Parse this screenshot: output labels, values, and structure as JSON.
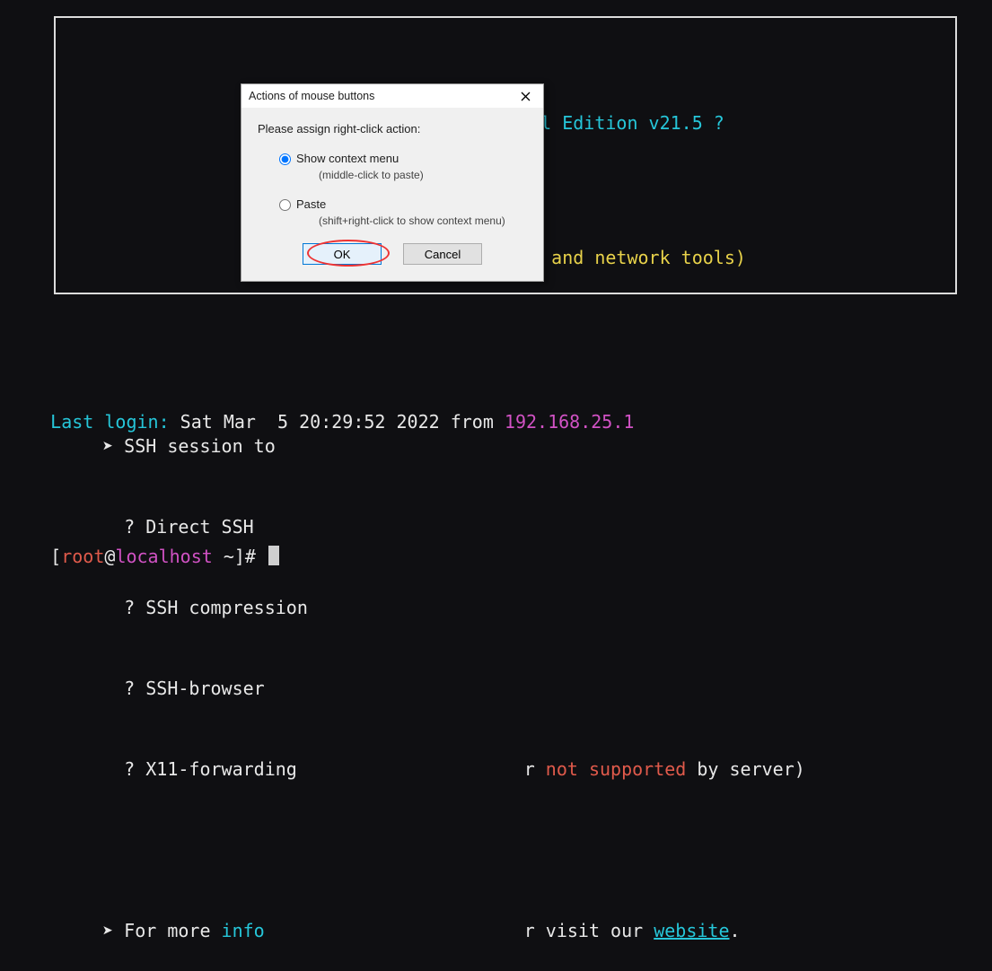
{
  "banner": {
    "title_line": "? MobaXterm Personal Edition v21.5 ?",
    "subtitle_line": "(SSH client, X server and network tools)",
    "lines": {
      "ssh_session_head": "SSH session to ",
      "direct_ssh": "Direct SSH",
      "ssh_compression": "SSH compression",
      "ssh_browser": "SSH-browser",
      "x11_forward_pre": "X11-forwarding",
      "x11_tail": "r ",
      "x11_not_supported": "not supported",
      "x11_by_server": " by server)",
      "more_pre": "For more ",
      "more_info": "info",
      "more_mid": "r visit our ",
      "more_link": "website",
      "more_dot": "."
    }
  },
  "below": {
    "last_login_label": "Last login:",
    "last_login_date": " Sat Mar  5 20:29:52 2022 from ",
    "last_login_ip": "192.168.25.1",
    "prompt_open": "[",
    "prompt_user": "root",
    "prompt_at": "@",
    "prompt_host": "localhost",
    "prompt_tail": " ~]# "
  },
  "dialog": {
    "title": "Actions of mouse buttons",
    "instruction": "Please assign right-click action:",
    "option1_label": "Show context menu",
    "option1_sub": "(middle-click to paste)",
    "option2_label": "Paste",
    "option2_sub": "(shift+right-click to show context menu)",
    "ok_label": "OK",
    "cancel_label": "Cancel"
  }
}
